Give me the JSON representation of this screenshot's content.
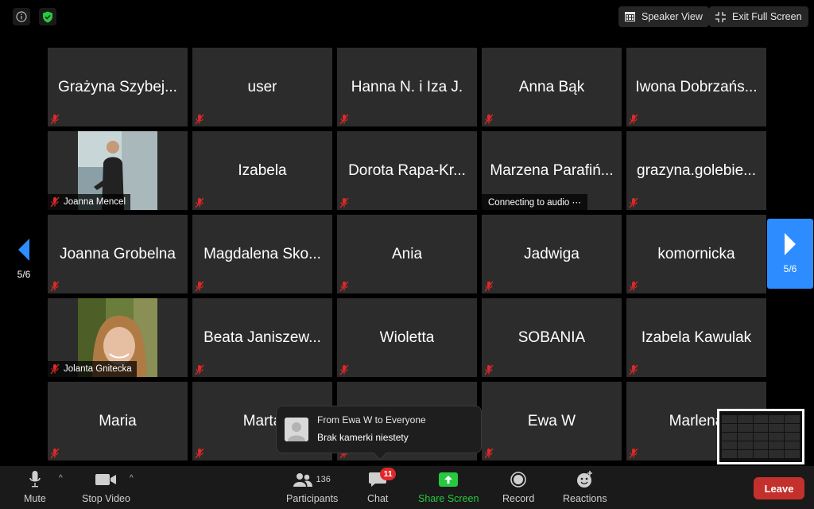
{
  "topbar": {
    "speaker_view_label": "Speaker View",
    "exit_fullscreen_label": "Exit Full Screen"
  },
  "participants": [
    {
      "name": "Grażyna Szybej...",
      "video": false,
      "status": ""
    },
    {
      "name": "user",
      "video": false,
      "status": ""
    },
    {
      "name": "Hanna N. i Iza J.",
      "video": false,
      "status": ""
    },
    {
      "name": "Anna Bąk",
      "video": false,
      "status": ""
    },
    {
      "name": "Iwona Dobrzańs...",
      "video": false,
      "status": ""
    },
    {
      "name": "Joanna Mencel",
      "video": true,
      "status": ""
    },
    {
      "name": "Izabela",
      "video": false,
      "status": ""
    },
    {
      "name": "Dorota Rapa-Kr...",
      "video": false,
      "status": ""
    },
    {
      "name": "Marzena Parafiń...",
      "video": false,
      "status": "Connecting to audio ⋯"
    },
    {
      "name": "grazyna.golebie...",
      "video": false,
      "status": ""
    },
    {
      "name": "Joanna Grobelna",
      "video": false,
      "status": ""
    },
    {
      "name": "Magdalena Sko...",
      "video": false,
      "status": ""
    },
    {
      "name": "Ania",
      "video": false,
      "status": ""
    },
    {
      "name": "Jadwiga",
      "video": false,
      "status": ""
    },
    {
      "name": "komornicka",
      "video": false,
      "status": ""
    },
    {
      "name": "Jolanta Gnitecka",
      "video": true,
      "status": ""
    },
    {
      "name": "Beata Janiszew...",
      "video": false,
      "status": ""
    },
    {
      "name": "Wioletta",
      "video": false,
      "status": ""
    },
    {
      "name": "SOBANIA",
      "video": false,
      "status": ""
    },
    {
      "name": "Izabela Kawulak",
      "video": false,
      "status": ""
    },
    {
      "name": "Maria",
      "video": false,
      "status": ""
    },
    {
      "name": "Marta",
      "video": false,
      "status": ""
    },
    {
      "name": "",
      "video": false,
      "status": ""
    },
    {
      "name": "Ewa W",
      "video": false,
      "status": ""
    },
    {
      "name": "Marlena",
      "video": false,
      "status": ""
    }
  ],
  "pagination": {
    "left_label": "5/6",
    "right_label": "5/6"
  },
  "chat_popup": {
    "from": "From Ewa W to Everyone",
    "message": "Brak kamerki niestety"
  },
  "toolbar": {
    "mute_label": "Mute",
    "stop_video_label": "Stop Video",
    "participants_label": "Participants",
    "participants_count": "136",
    "chat_label": "Chat",
    "chat_badge": "11",
    "share_label": "Share Screen",
    "record_label": "Record",
    "reactions_label": "Reactions",
    "leave_label": "Leave"
  },
  "colors": {
    "accent": "#2d8cff",
    "share_green": "#28c840",
    "leave_red": "#c4302b",
    "badge_red": "#e02828",
    "tile_bg": "#2c2c2c"
  },
  "icons": {
    "info": "info-icon",
    "security": "shield-icon",
    "speaker_view": "grid-icon",
    "exit_fullscreen": "collapse-icon",
    "muted": "mic-off-icon"
  }
}
